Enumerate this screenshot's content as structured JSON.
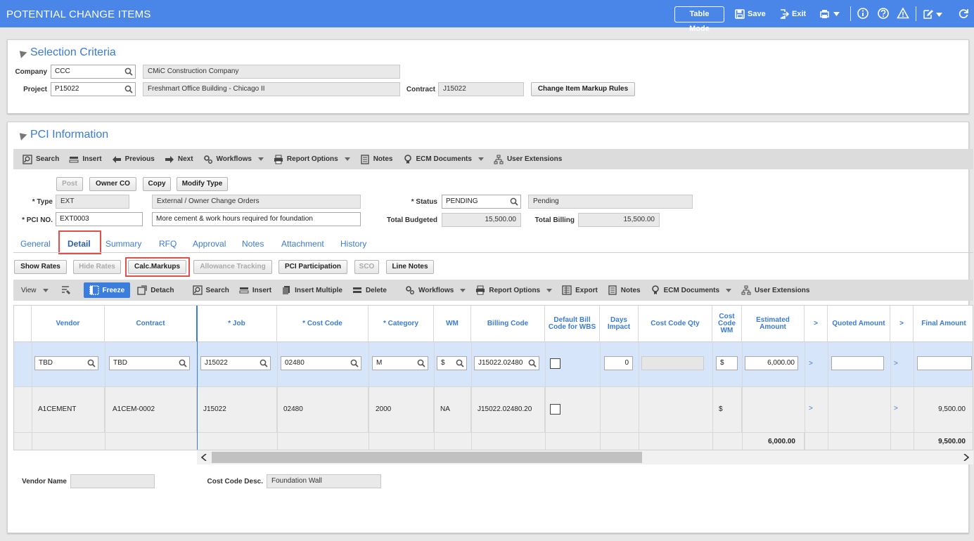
{
  "app": {
    "title": "POTENTIAL CHANGE ITEMS",
    "table_mode": "Table Mode",
    "save": "Save",
    "exit": "Exit"
  },
  "selection": {
    "title": "Selection Criteria",
    "company_label": "Company",
    "company": "CCC",
    "company_name": "CMiC Construction Company",
    "project_label": "Project",
    "project": "P15022",
    "project_name": "Freshmart Office Building - Chicago II",
    "contract_label": "Contract",
    "contract": "J15022",
    "markup_button": "Change Item Markup Rules"
  },
  "pci": {
    "title": "PCI Information",
    "toolbar": {
      "search": "Search",
      "insert": "Insert",
      "previous": "Previous",
      "next": "Next",
      "workflows": "Workflows",
      "report_options": "Report Options",
      "notes": "Notes",
      "ecm": "ECM Documents",
      "user_ext": "User Extensions"
    },
    "buttons": {
      "post": "Post",
      "owner_co": "Owner CO",
      "copy": "Copy",
      "modify_type": "Modify Type"
    },
    "type_label": "* Type",
    "type": "EXT",
    "type_desc": "External / Owner Change Orders",
    "pci_label": "* PCI NO.",
    "pci_no": "EXT0003",
    "pci_desc": "More cement & work hours required for foundation",
    "status_label": "* Status",
    "status": "PENDING",
    "status_desc": "Pending",
    "total_budgeted_label": "Total Budgeted",
    "total_budgeted": "15,500.00",
    "total_billing_label": "Total Billing",
    "total_billing": "15,500.00"
  },
  "tabs": [
    "General",
    "Detail",
    "Summary",
    "RFQ",
    "Approval",
    "Notes",
    "Attachment",
    "History"
  ],
  "detail_buttons": {
    "show_rates": "Show Rates",
    "hide_rates": "Hide Rates",
    "calc_markups": "Calc.Markups",
    "allowance": "Allowance Tracking",
    "pci_participation": "PCI Participation",
    "sco": "SCO",
    "line_notes": "Line Notes"
  },
  "grid_toolbar": {
    "view": "View",
    "freeze": "Freeze",
    "detach": "Detach",
    "search": "Search",
    "insert": "Insert",
    "insert_multiple": "Insert Multiple",
    "delete": "Delete",
    "workflows": "Workflows",
    "report_options": "Report Options",
    "export": "Export",
    "notes": "Notes",
    "ecm": "ECM Documents",
    "user_ext": "User Extensions"
  },
  "grid": {
    "headers": {
      "vendor": "Vendor",
      "contract": "Contract",
      "job": "* Job",
      "cost_code": "* Cost Code",
      "category": "* Category",
      "wm": "WM",
      "billing_code": "Billing Code",
      "default_bill": "Default Bill Code for WBS",
      "days_impact": "Days Impact",
      "cost_code_qty": "Cost Code Qty",
      "cost_code_wm": "Cost Code WM",
      "estimated": "Estimated Amount",
      "gt1": ">",
      "quoted": "Quoted Amount",
      "gt2": ">",
      "final": "Final Amount"
    },
    "edit_row": {
      "vendor": "TBD",
      "contract": "TBD",
      "job": "J15022",
      "cost_code": "02480",
      "category": "M",
      "wm": "$",
      "billing_code": "J15022.02480",
      "days_impact": "0",
      "cost_code_wm": "$",
      "estimated": "6,000.00",
      "gt1": ">",
      "gt2": ">"
    },
    "row": {
      "vendor": "A1CEMENT",
      "contract": "A1CEM-0002",
      "job": "J15022",
      "cost_code": "02480",
      "category": "2000",
      "wm": "NA",
      "billing_code": "J15022.02480.20",
      "cost_code_wm": "$",
      "gt1": ">",
      "gt2": ">",
      "final": "9,500.00"
    },
    "totals": {
      "estimated": "6,000.00",
      "final": "9,500.00"
    }
  },
  "footer": {
    "vendor_name_label": "Vendor Name",
    "vendor_name": "",
    "cost_code_desc_label": "Cost Code Desc.",
    "cost_code_desc": "Foundation Wall"
  }
}
